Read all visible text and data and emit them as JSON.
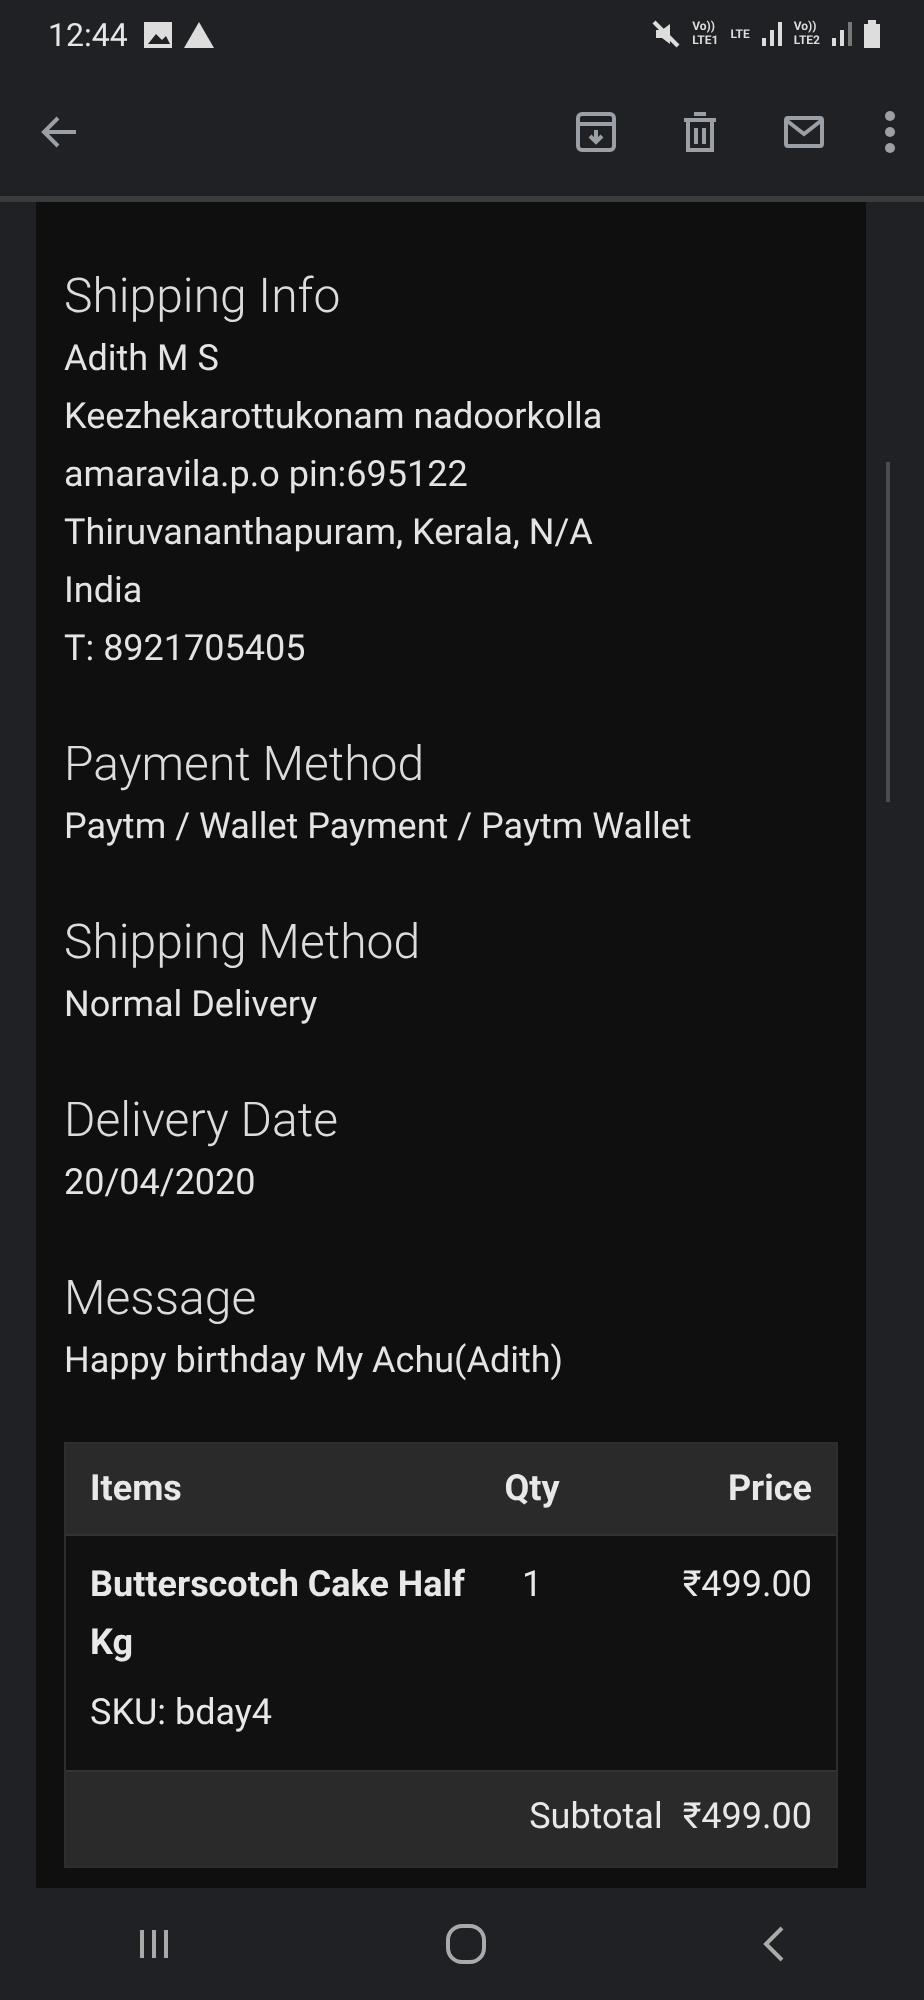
{
  "status_bar": {
    "time": "12:44",
    "sim1": [
      "Vo))",
      "LTE1"
    ],
    "data": "LTE",
    "sim2": [
      "Vo))",
      "LTE2"
    ]
  },
  "sections": [
    {
      "title": "Shipping Info",
      "lines": [
        "Adith M S",
        "Keezhekarottukonam nadoorkolla",
        "amaravila.p.o pin:695122",
        "Thiruvananthapuram, Kerala, N/A",
        "India",
        "T: 8921705405"
      ]
    },
    {
      "title": "Payment Method",
      "lines": [
        "Paytm / Wallet Payment / Paytm Wallet"
      ]
    },
    {
      "title": "Shipping Method",
      "lines": [
        "Normal Delivery"
      ]
    },
    {
      "title": "Delivery Date",
      "lines": [
        "20/04/2020"
      ]
    },
    {
      "title": "Message",
      "lines": [
        "Happy birthday My Achu(Adith)"
      ]
    }
  ],
  "table": {
    "columns": [
      "Items",
      "Qty",
      "Price"
    ],
    "rows": [
      {
        "name": "Butterscotch Cake Half Kg",
        "sku": "SKU: bday4",
        "qty": "1",
        "price": "₹499.00"
      }
    ],
    "totals": [
      {
        "label": "Subtotal",
        "value": "₹499.00"
      }
    ]
  }
}
